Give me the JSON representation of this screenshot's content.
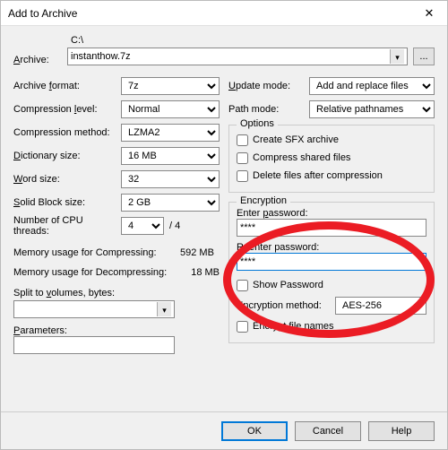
{
  "window": {
    "title": "Add to Archive"
  },
  "archive": {
    "label": "Archive:",
    "path": "C:\\",
    "filename": "instanthow.7z",
    "browse": "..."
  },
  "left": {
    "format": {
      "label_pre": "Archive ",
      "label_u": "f",
      "label_post": "ormat:",
      "value": "7z"
    },
    "level": {
      "label": "Compression ",
      "label_u": "l",
      "label_post": "evel:",
      "value": "Normal"
    },
    "method": {
      "label": "Compression method:",
      "value": "LZMA2"
    },
    "dict": {
      "label_u": "D",
      "label_post": "ictionary size:",
      "value": "16 MB"
    },
    "word": {
      "label_u": "W",
      "label_post": "ord size:",
      "value": "32"
    },
    "solid": {
      "label_u": "S",
      "label_post": "olid Block size:",
      "value": "2 GB"
    },
    "threads": {
      "label": "Number of CPU threads:",
      "value": "4",
      "max": "/ 4"
    },
    "mem_comp": {
      "label": "Memory usage for Compressing:",
      "value": "592 MB"
    },
    "mem_decomp": {
      "label": "Memory usage for Decompressing:",
      "value": "18 MB"
    },
    "split": {
      "label": "Split to ",
      "label_u": "v",
      "label_post": "olumes, bytes:",
      "value": ""
    },
    "params": {
      "label_u": "P",
      "label_post": "arameters:",
      "value": ""
    }
  },
  "right": {
    "update": {
      "label_u": "U",
      "label_post": "pdate mode:",
      "value": "Add and replace files"
    },
    "pathmode": {
      "label": "Path mode:",
      "value": "Relative pathnames"
    },
    "options": {
      "title": "Options",
      "sfx": "Create SFX archive",
      "shared": "Compress shared files",
      "delete": "Delete files after compression"
    },
    "enc": {
      "title": "Encryption",
      "enter": "Enter password:",
      "reenter": "Reenter password:",
      "pw1": "****",
      "pw2": "****",
      "show": "Show Password",
      "method_label": "Encryption method:",
      "method_value": "AES-256",
      "names": "Encrypt file names"
    }
  },
  "footer": {
    "ok": "OK",
    "cancel": "Cancel",
    "help": "Help"
  }
}
